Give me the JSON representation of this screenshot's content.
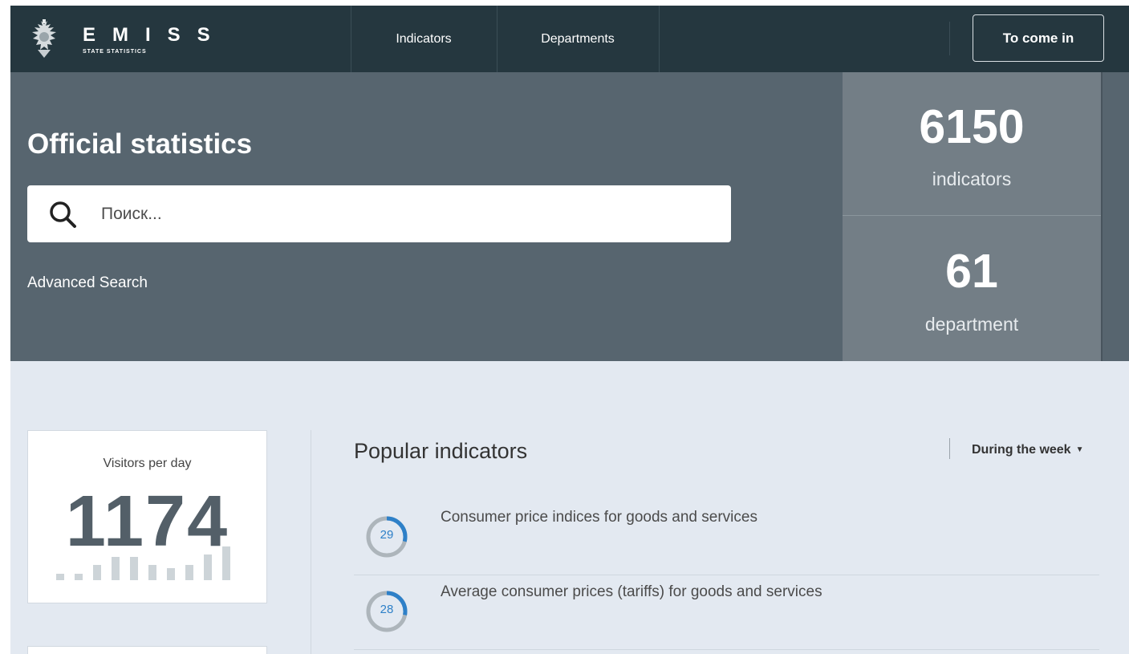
{
  "header": {
    "brand_title": "EMISS",
    "brand_subtitle": "STATE STATISTICS",
    "nav": [
      {
        "label": "Indicators"
      },
      {
        "label": "Departments"
      }
    ],
    "login_label": "To come in"
  },
  "hero": {
    "title": "Official statistics",
    "search": {
      "placeholder": "Поиск...",
      "value": ""
    },
    "advanced_search": "Advanced Search",
    "stats": [
      {
        "value": "6150",
        "label": "indicators"
      },
      {
        "value": "61",
        "label": "department"
      }
    ]
  },
  "visitors": {
    "label": "Visitors per day",
    "value": "1174",
    "trend": [
      0.2,
      0.2,
      0.45,
      0.7,
      0.7,
      0.45,
      0.35,
      0.45,
      0.75,
      1.0
    ]
  },
  "popular": {
    "title": "Popular indicators",
    "period": "During the week",
    "items": [
      {
        "count": "29",
        "label": "Consumer price indices for goods and services",
        "share": 0.29
      },
      {
        "count": "28",
        "label": "Average consumer prices (tariffs) for goods and services",
        "share": 0.28
      }
    ]
  },
  "colors": {
    "topbar": "#25373f",
    "hero": "#57656f",
    "stats_panel": "#737e86",
    "page_bg": "#e3e9f1",
    "accent": "#2e80c8"
  }
}
